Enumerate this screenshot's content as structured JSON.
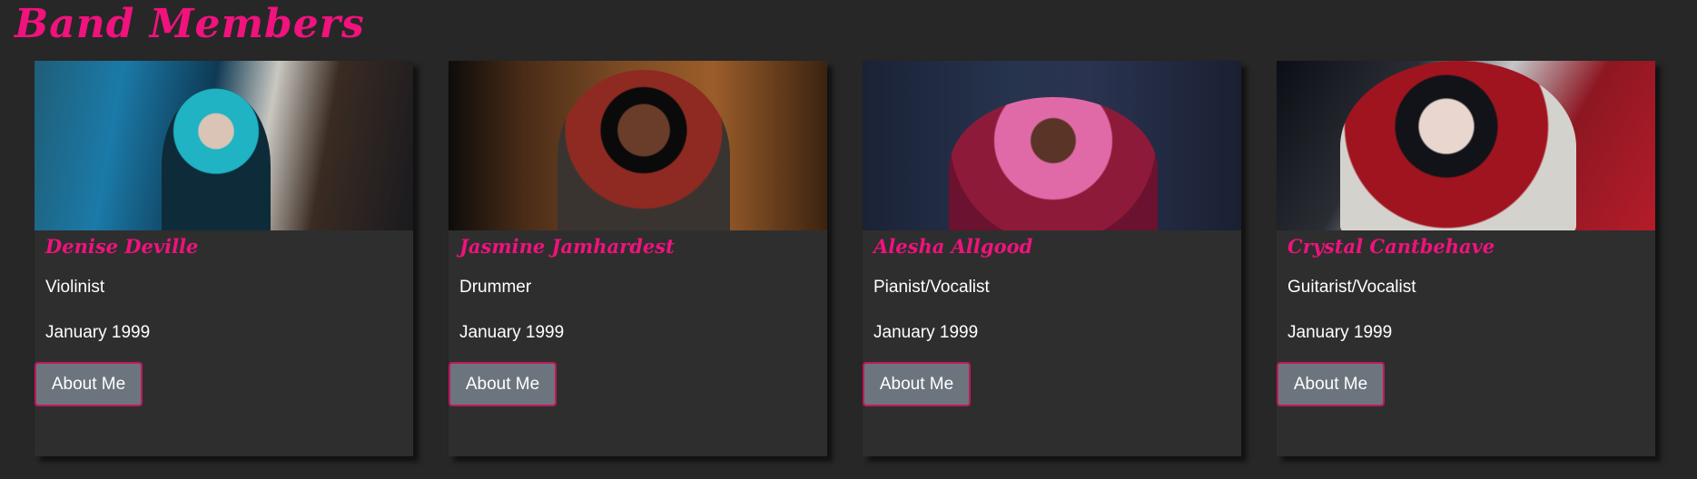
{
  "page": {
    "title": "Band Members"
  },
  "members": [
    {
      "name": "Denise Deville",
      "role": "Violinist",
      "date": "January 1999",
      "button_label": "About Me",
      "photo_alt": "Denise Deville photo"
    },
    {
      "name": "Jasmine Jamhardest",
      "role": "Drummer",
      "date": "January 1999",
      "button_label": "About Me",
      "photo_alt": "Jasmine Jamhardest photo"
    },
    {
      "name": "Alesha Allgood",
      "role": "Pianist/Vocalist",
      "date": "January 1999",
      "button_label": "About Me",
      "photo_alt": "Alesha Allgood photo"
    },
    {
      "name": "Crystal Cantbehave",
      "role": "Guitarist/Vocalist",
      "date": "January 1999",
      "button_label": "About Me",
      "photo_alt": "Crystal Cantbehave photo"
    }
  ],
  "colors": {
    "accent": "#f0127d",
    "background": "#272727",
    "card": "#2e2e2e",
    "button": "#6c757d",
    "button_border": "#c2185b"
  }
}
